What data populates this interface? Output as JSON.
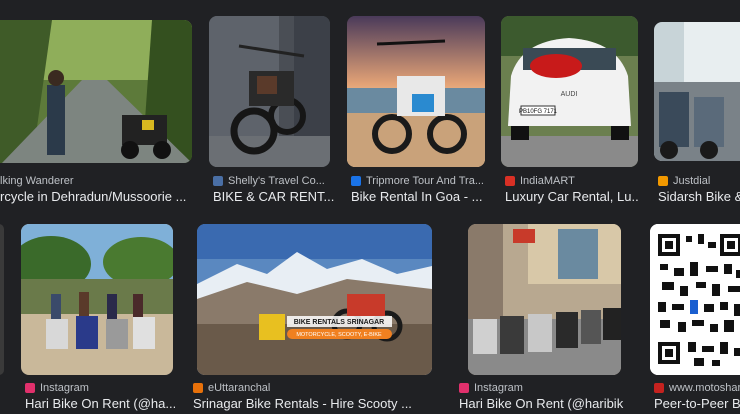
{
  "results": [
    {
      "source": "lking Wanderer",
      "title": "rcycle in Dehradun/Mussoorie ...",
      "favicon": "none",
      "fav_color": ""
    },
    {
      "source": "Shelly's Travel Co...",
      "title": "BIKE & CAR RENT...",
      "favicon": "travel-favicon-icon",
      "fav_color": "#4a6fa5"
    },
    {
      "source": "Tripmore Tour And Tra...",
      "title": "Bike Rental In Goa - ...",
      "favicon": "tripmore-favicon-icon",
      "fav_color": "#1a73e8"
    },
    {
      "source": "IndiaMART",
      "title": "Luxury Car Rental, Lu...",
      "favicon": "indiamart-favicon-icon",
      "fav_color": "#d93025"
    },
    {
      "source": "Justdial",
      "title": "Sidarsh Bike & ...",
      "favicon": "justdial-favicon-icon",
      "fav_color": "#f29900"
    },
    {
      "source": "Instagram",
      "title": "Hari Bike On Rent (@ha...",
      "favicon": "instagram-favicon-icon",
      "fav_color": "#e1306c"
    },
    {
      "source": "eUttaranchal",
      "title": "Srinagar Bike Rentals - Hire Scooty ...",
      "favicon": "euttaranchal-favicon-icon",
      "fav_color": "#e8710a"
    },
    {
      "source": "Instagram",
      "title": "Hari Bike On Rent (@haribik...",
      "favicon": "instagram-favicon-icon",
      "fav_color": "#e1306c"
    },
    {
      "source": "www.motoshare",
      "title": "Peer-to-Peer Bik",
      "favicon": "motoshare-favicon-icon",
      "fav_color": "#c5221f"
    }
  ],
  "srinagar_banner": {
    "name": "BIKE RENTALS SRINAGAR",
    "tagline": "MOTORCYCLE, SCOOTY, E-BIKE"
  },
  "car_plate": "PB10FG 7171",
  "car_brand": "AUDI"
}
